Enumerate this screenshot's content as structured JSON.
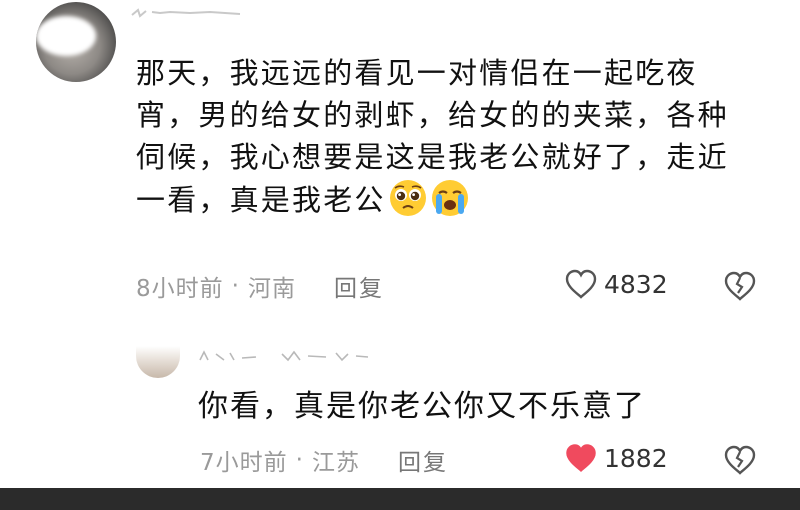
{
  "comments": [
    {
      "text": "那天，我远远的看见一对情侣在一起吃夜宵，男的给女的剥虾，给女的的夹菜，各种伺候，我心想要是这是我老公就好了，走近一看，真是我老公",
      "emojis": [
        "pleading-face-icon",
        "crying-face-icon"
      ],
      "time": "8小时前",
      "separator": "·",
      "location": "河南",
      "reply_label": "回复",
      "likes": "4832",
      "liked": false,
      "like_color": "#555555"
    },
    {
      "text": "你看，真是你老公你又不乐意了",
      "time": "7小时前",
      "separator": "·",
      "location": "江苏",
      "reply_label": "回复",
      "likes": "1882",
      "liked": true,
      "like_color": "#f04a5e"
    }
  ]
}
